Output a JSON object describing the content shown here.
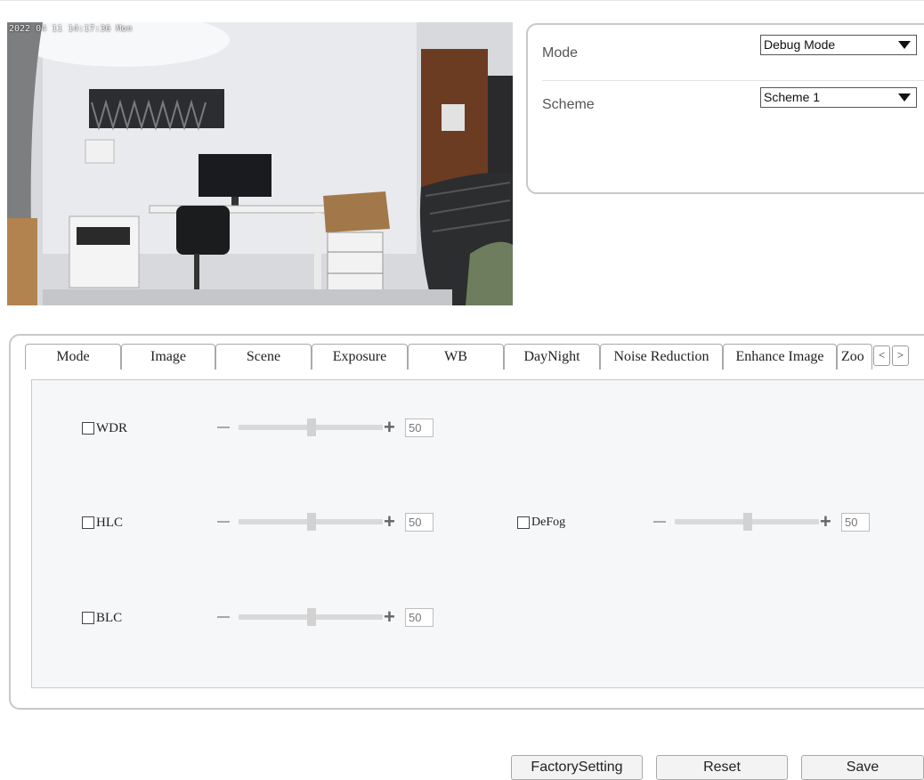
{
  "video": {
    "timestamp": "2022 04 11 14:17:36 Mon"
  },
  "mode_panel": {
    "mode_label": "Mode",
    "mode_value": "Debug Mode",
    "scheme_label": "Scheme",
    "scheme_value": "Scheme 1"
  },
  "tabs": {
    "items": [
      "Mode",
      "Image",
      "Scene",
      "Exposure",
      "WB",
      "DayNight",
      "Noise Reduction",
      "Enhance Image",
      "Zoo"
    ],
    "active": "Enhance Image",
    "prev_label": "<",
    "next_label": ">"
  },
  "enhance": {
    "wdr": {
      "label": "WDR",
      "checked": false,
      "value": "50"
    },
    "hlc": {
      "label": "HLC",
      "checked": false,
      "value": "50"
    },
    "blc": {
      "label": "BLC",
      "checked": false,
      "value": "50"
    },
    "defog": {
      "label": "DeFog",
      "checked": false,
      "value": "50"
    },
    "plus_symbol": "+"
  },
  "buttons": {
    "factory": "FactorySetting",
    "reset": "Reset",
    "save": "Save"
  }
}
